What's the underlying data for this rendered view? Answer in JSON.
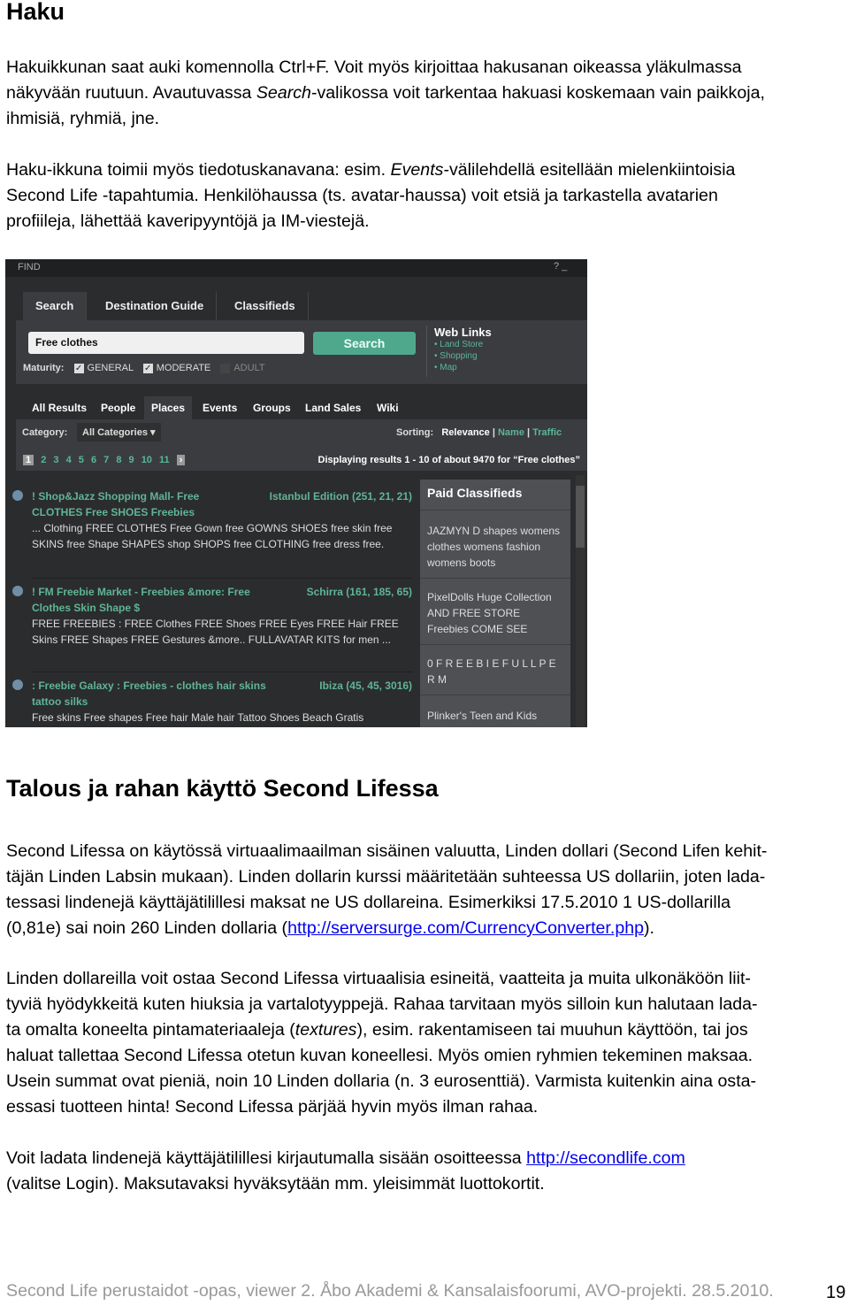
{
  "heading1": "Haku",
  "p1": [
    "Hakuikkunan saat auki komennolla Ctrl+F. Voit myös kirjoittaa hakusanan oikeassa yläkulmassa",
    "näkyvään ruutuun. Avautuvassa ",
    "Search",
    "-valikossa voit tarkentaa hakuasi koskemaan vain paikkoja,",
    "ihmisiä, ryhmiä, jne."
  ],
  "p2": [
    "Haku-ikkuna toimii myös tiedotuskanavana: esim. ",
    "Events",
    "-välilehdellä esitellään mielenkiintoisia",
    "Second Life -tapahtumia. Henkilöhaussa (ts. avatar-haussa) voit etsiä ja tarkastella avatarien",
    "profiileja, lähettää kaveripyyntöjä ja IM-viestejä."
  ],
  "find": {
    "title": "FIND",
    "title_controls": "? _",
    "tabs": [
      "Search",
      "Destination Guide",
      "Classifieds"
    ],
    "search_value": "Free clothes",
    "search_button": "Search",
    "maturity_label": "Maturity:",
    "maturity": [
      {
        "label": "GENERAL",
        "checked": true
      },
      {
        "label": "MODERATE",
        "checked": true
      },
      {
        "label": "ADULT",
        "checked": false
      }
    ],
    "web_links_title": "Web Links",
    "web_links": [
      "Land Store",
      "Shopping",
      "Map"
    ],
    "subtabs": [
      "All Results",
      "People",
      "Places",
      "Events",
      "Groups",
      "Land Sales",
      "Wiki"
    ],
    "active_subtab": "Places",
    "category_label": "Category:",
    "category_value": "All Categories",
    "sorting_label": "Sorting:",
    "sorting": [
      "Relevance",
      "Name",
      "Traffic"
    ],
    "pages": [
      "1",
      "2",
      "3",
      "4",
      "5",
      "6",
      "7",
      "8",
      "9",
      "10",
      "11"
    ],
    "displaying": "Displaying results 1 - 10 of about 9470 for “Free clothes”",
    "results": [
      {
        "title": "! Shop&Jazz Shopping Mall- Free CLOTHES Free SHOES Freebies",
        "location": "Istanbul Edition (251, 21, 21)",
        "desc": "... Clothing FREE CLOTHES Free Gown free GOWNS SHOES free skin free SKINS free Shape SHAPES shop SHOPS free CLOTHING free dress free."
      },
      {
        "title": "! FM Freebie Market - Freebies &more: Free Clothes Skin Shape $",
        "location": "Schirra (161, 185, 65)",
        "desc": "FREE FREEBIES : FREE Clothes FREE Shoes FREE Eyes FREE Hair FREE Skins FREE Shapes FREE Gestures &more.. FULLAVATAR KITS for men ..."
      },
      {
        "title": ": Freebie Galaxy : Freebies - clothes hair skins tattoo silks",
        "location": "Ibiza (45, 45, 3016)",
        "desc": "Free skins Free shapes Free hair Male hair Tattoo Shoes Beach Gratis"
      }
    ],
    "paid_title": "Paid Classifieds",
    "paid": [
      "JAZMYN D shapes womens clothes womens fashion womens boots",
      "PixelDolls Huge Collection AND FREE STORE Freebies COME SEE",
      "0 F R E E B I E F U L L P E R M",
      "Plinker's Teen and Kids Boutique Underoity - Skins &"
    ]
  },
  "heading2": "Talous ja rahan käyttö Second Lifessa",
  "p3": [
    "Second Lifessa on käytössä virtuaalimaailman sisäinen valuutta, Linden dollari (Second Lifen kehit-",
    "täjän Linden Labsin mukaan). Linden dollarin kurssi määritetään suhteessa US dollariin, joten lada-",
    "tessasi lindenejä käyttäjätilillesi maksat ne US dollareina. Esimerkiksi 17.5.2010 1 US-dollarilla",
    "(0,81e) sai noin 260 Linden dollaria (",
    "http://serversurge.com/CurrencyConverter.php",
    ")."
  ],
  "p4": [
    "Linden dollareilla voit ostaa Second Lifessa virtuaalisia esineitä, vaatteita ja muita ulkonäköön liit-",
    "tyviä hyödykkeitä kuten hiuksia ja vartalotyyppejä. Rahaa tarvitaan myös silloin kun halutaan lada-",
    "ta omalta koneelta pintamateriaaleja (",
    "textures",
    "), esim. rakentamiseen tai muuhun käyttöön, tai jos",
    "haluat tallettaa Second Lifessa otetun kuvan koneellesi. Myös omien ryhmien tekeminen maksaa.",
    "Usein summat ovat pieniä, noin 10 Linden dollaria (n. 3 eurosenttiä). Varmista kuitenkin aina osta-",
    "essasi tuotteen hinta! Second Lifessa pärjää hyvin myös ilman rahaa."
  ],
  "p5": [
    "Voit ladata lindenejä käyttäjätilillesi kirjautumalla sisään osoitteessa ",
    "http://secondlife.com",
    "(valitse Login). Maksutavaksi hyväksytään mm. yleisimmät luottokortit."
  ],
  "footer": "Second Life perustaidot -opas, viewer 2. Åbo Akademi & Kansalaisfoorumi, AVO-projekti. 28.5.2010.",
  "page_number": "19"
}
